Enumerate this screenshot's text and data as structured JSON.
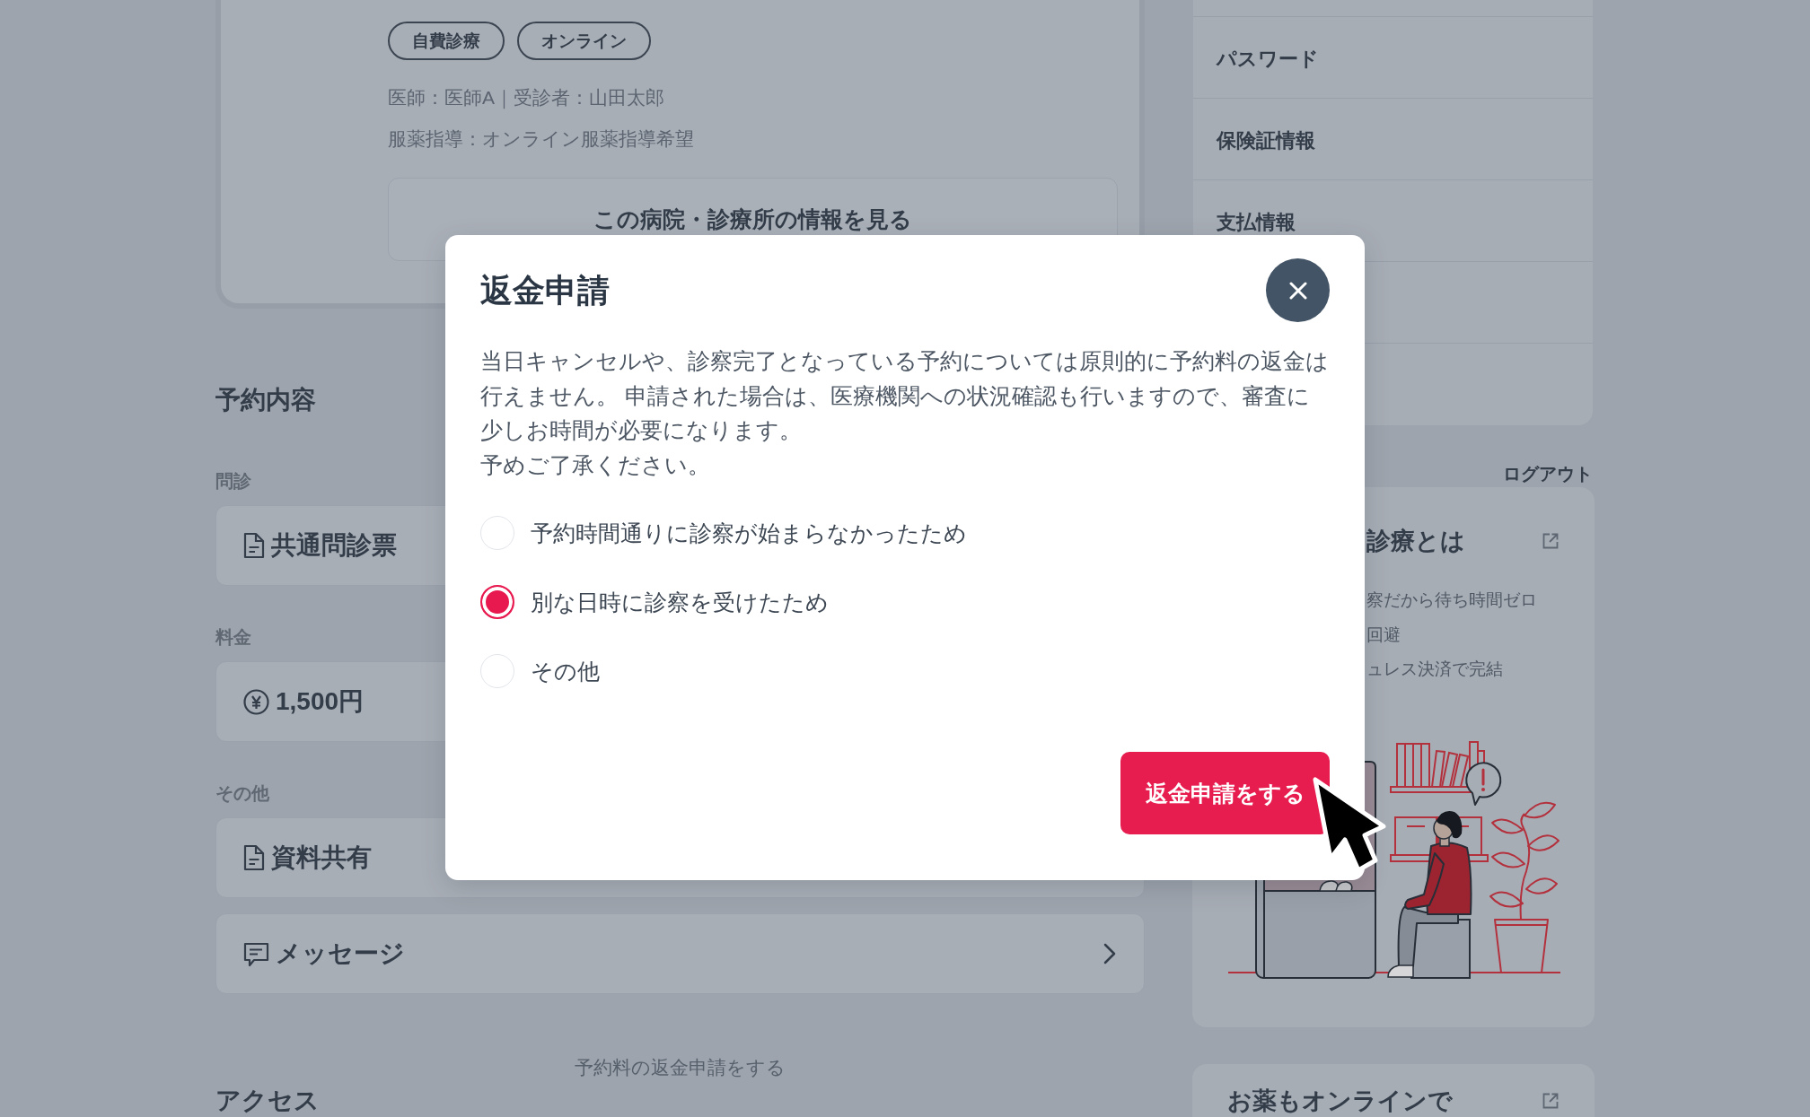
{
  "clinic_card": {
    "tags": [
      "自費診療",
      "オンライン"
    ],
    "details": [
      "医師：医師A｜受診者：山田太郎",
      "服薬指導：オンライン服薬指導希望"
    ],
    "info_button": "この病院・診療所の情報を見る"
  },
  "reservation": {
    "heading": "予約内容",
    "sections": [
      {
        "label": "問診",
        "items": [
          {
            "kind": "document",
            "text": "共通問診票"
          }
        ]
      },
      {
        "label": "料金",
        "items": [
          {
            "kind": "price",
            "text": "1,500円"
          }
        ]
      },
      {
        "label": "その他",
        "items": [
          {
            "kind": "document",
            "text": "資料共有"
          },
          {
            "kind": "message",
            "text": "メッセージ"
          }
        ]
      }
    ],
    "refund_link": "予約料の返金申請をする",
    "next_heading": "アクセス"
  },
  "sidebar": {
    "menu": [
      {
        "label": "パスワード"
      },
      {
        "label": "保険証情報"
      },
      {
        "label": "支払情報"
      }
    ],
    "logout": "ログアウト"
  },
  "info_card": {
    "title": "診療とは",
    "points": [
      "察だから待ち時間ゼロ",
      "回避",
      "ュレス決済で完結"
    ]
  },
  "promo_card": {
    "title": "お薬もオンラインで"
  },
  "modal": {
    "title": "返金申請",
    "paragraphs": [
      "当日キャンセルや、診察完了となっている予約については原則的に予約料の返金は行えません。 申請された場合は、医療機関への状況確認も行いますので、審査に少しお時間が必要になります。",
      "予めご了承ください。"
    ],
    "options": [
      {
        "label": "予約時間通りに診察が始まらなかったため",
        "selected": false
      },
      {
        "label": "別な日時に診察を受けたため",
        "selected": true
      },
      {
        "label": "その他",
        "selected": false
      }
    ],
    "submit": "返金申請をする"
  }
}
